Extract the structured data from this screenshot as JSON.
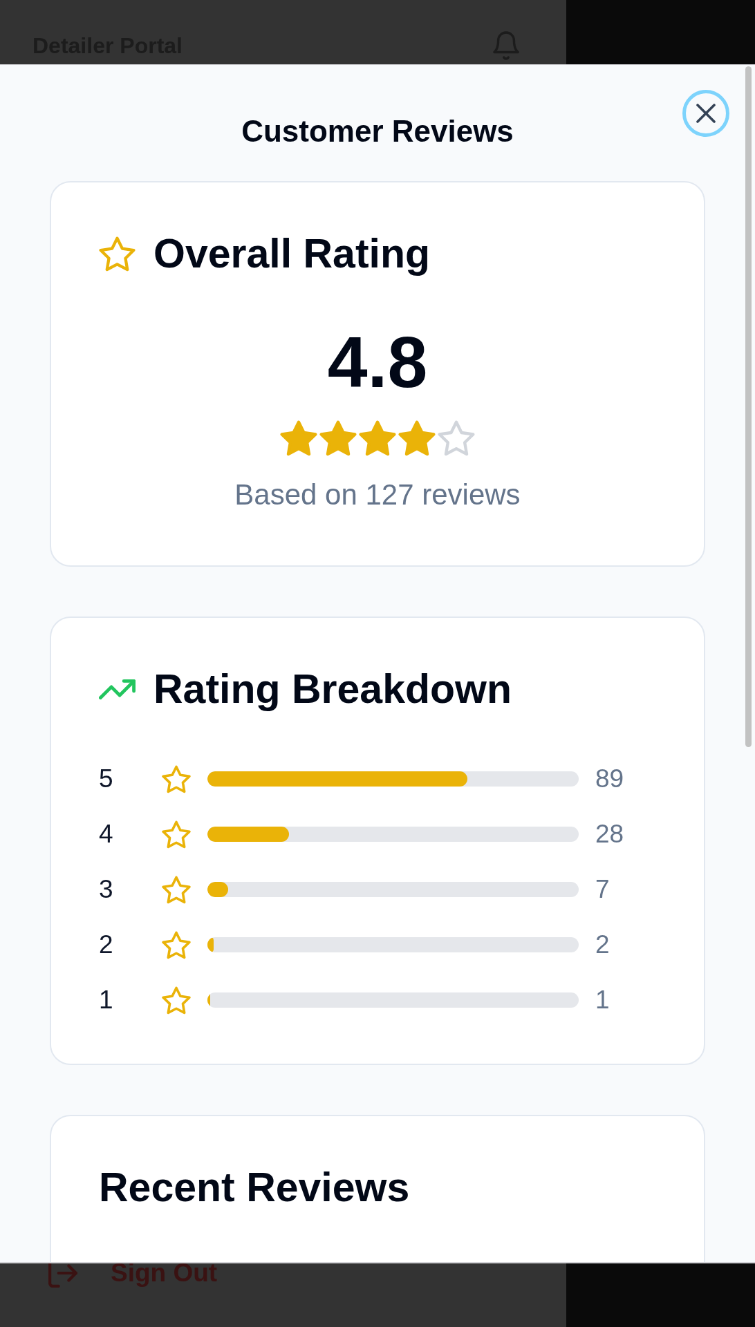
{
  "background_page": {
    "app_title": "Detailer Portal",
    "sign_out": "Sign Out"
  },
  "modal": {
    "title": "Customer Reviews"
  },
  "overall_rating": {
    "heading": "Overall Rating",
    "score": "4.8",
    "stars": 4,
    "caption": "Based on 127 reviews"
  },
  "rating_breakdown": {
    "heading": "Rating Breakdown",
    "rows": [
      {
        "rating": "5",
        "level": 0.7,
        "count": "89"
      },
      {
        "rating": "4",
        "level": 0.22,
        "count": "28"
      },
      {
        "rating": "3",
        "level": 0.055,
        "count": "7"
      },
      {
        "rating": "2",
        "level": 0.016,
        "count": "2"
      },
      {
        "rating": "1",
        "level": 0.008,
        "count": "1"
      }
    ]
  },
  "recent_reviews": {
    "heading": "Recent Reviews"
  }
}
